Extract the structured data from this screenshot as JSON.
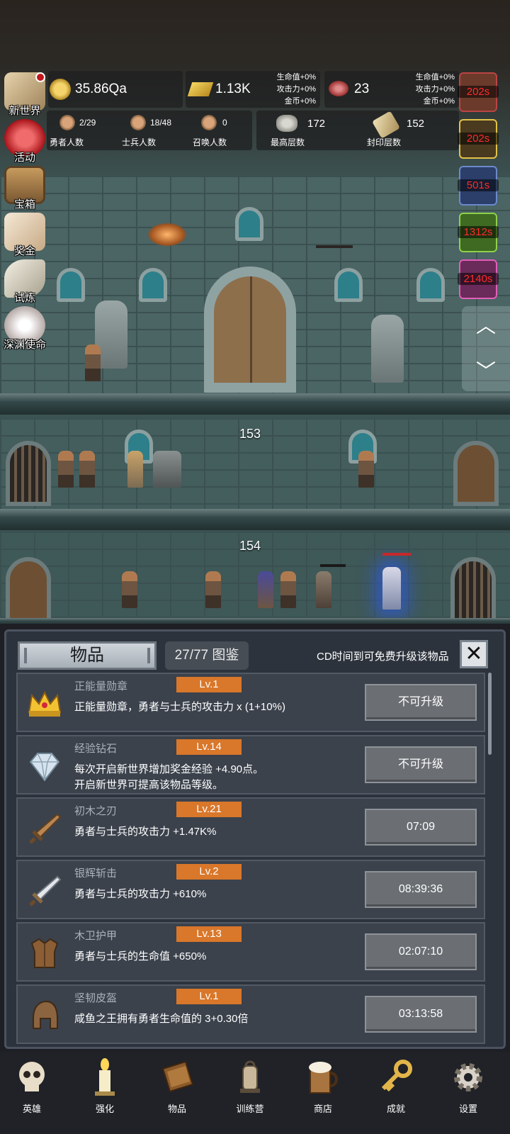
{
  "hud": {
    "gold": "35.86Qa",
    "bars": "1.13K",
    "bars_stats": [
      "生命值+0%",
      "攻击力+0%",
      "金币+0%"
    ],
    "meat": "23",
    "meat_stats": [
      "生命值+0%",
      "攻击力+0%",
      "金币+0%"
    ],
    "heroes_value": "2/29",
    "heroes_label": "勇者人数",
    "soldiers_value": "18/48",
    "soldiers_label": "士兵人数",
    "summon_value": "0",
    "summon_label": "召唤人数",
    "max_floor_value": "172",
    "max_floor_label": "最高层数",
    "sealed_value": "152",
    "sealed_label": "封印层数"
  },
  "side_menu": [
    {
      "label": "新世界",
      "icon": "map-icon"
    },
    {
      "label": "活动",
      "icon": "heart-icon"
    },
    {
      "label": "宝箱",
      "icon": "chest-icon"
    },
    {
      "label": "奖金",
      "icon": "envelope-icon"
    },
    {
      "label": "试炼",
      "icon": "feather-icon"
    },
    {
      "label": "深渊使命",
      "icon": "pearl-icon"
    }
  ],
  "timers": [
    "202s",
    "202s",
    "501s",
    "1312s",
    "2140s"
  ],
  "scroll_controls": {
    "up": "︿",
    "down": "﹀"
  },
  "floors": {
    "a": "153",
    "b": "154"
  },
  "panel": {
    "tab_items": "物品",
    "tab_catalog": "27/77 图鉴",
    "cd_tip": "CD时间到可免费升级该物品",
    "close": "✕"
  },
  "items": [
    {
      "name": "正能量勋章",
      "level": "Lv.1",
      "desc": [
        "正能量勋章，勇者与士兵的攻击力 x (1+10%)"
      ],
      "button": "不可升级",
      "icon": "crown-icon"
    },
    {
      "name": "经验钻石",
      "level": "Lv.14",
      "desc": [
        "每次开启新世界增加奖金经验 +4.90点。",
        "开启新世界可提高该物品等级。"
      ],
      "button": "不可升级",
      "icon": "diamond-icon"
    },
    {
      "name": "初木之刃",
      "level": "Lv.21",
      "desc": [
        "勇者与士兵的攻击力 +1.47K%"
      ],
      "button": "07:09",
      "icon": "wooden-sword-icon"
    },
    {
      "name": "银辉斩击",
      "level": "Lv.2",
      "desc": [
        "勇者与士兵的攻击力 +610%"
      ],
      "button": "08:39:36",
      "icon": "silver-sword-icon"
    },
    {
      "name": "木卫护甲",
      "level": "Lv.13",
      "desc": [
        "勇者与士兵的生命值 +650%"
      ],
      "button": "02:07:10",
      "icon": "armor-icon"
    },
    {
      "name": "坚韧皮盔",
      "level": "Lv.1",
      "desc": [
        "咸鱼之王拥有勇者生命值的 3+0.30倍"
      ],
      "button": "03:13:58",
      "icon": "helmet-icon"
    }
  ],
  "nav": [
    {
      "label": "英雄",
      "icon": "skull-icon"
    },
    {
      "label": "强化",
      "icon": "candle-icon"
    },
    {
      "label": "物品",
      "icon": "book-icon"
    },
    {
      "label": "训练营",
      "icon": "lantern-icon"
    },
    {
      "label": "商店",
      "icon": "mug-icon"
    },
    {
      "label": "成就",
      "icon": "key-icon"
    },
    {
      "label": "设置",
      "icon": "gear-icon"
    }
  ]
}
